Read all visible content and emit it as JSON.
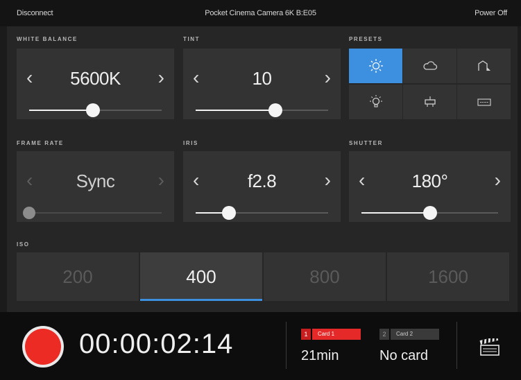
{
  "topbar": {
    "disconnect": "Disconnect",
    "camera_name": "Pocket Cinema Camera 6K B:E05",
    "power_off": "Power Off"
  },
  "white_balance": {
    "label": "WHITE BALANCE",
    "value": "5600K",
    "slider_level": 0.48
  },
  "tint": {
    "label": "TINT",
    "value": "10",
    "slider_level": 0.6
  },
  "presets": {
    "label": "PRESETS",
    "items": [
      {
        "icon": "sun-icon",
        "active": true
      },
      {
        "icon": "cloud-icon",
        "active": false
      },
      {
        "icon": "shade-icon",
        "active": false
      },
      {
        "icon": "tungsten-bulb-icon",
        "active": false
      },
      {
        "icon": "fluorescent-icon",
        "active": false
      },
      {
        "icon": "custom-icon",
        "active": false
      }
    ]
  },
  "frame_rate": {
    "label": "FRAME RATE",
    "value": "Sync",
    "slider_level": 0.0
  },
  "iris": {
    "label": "IRIS",
    "value": "f2.8",
    "slider_level": 0.25
  },
  "shutter": {
    "label": "SHUTTER",
    "value": "180°",
    "slider_level": 0.5
  },
  "iso": {
    "label": "ISO",
    "options": [
      "200",
      "400",
      "800",
      "1600"
    ],
    "selected": "400"
  },
  "record": {
    "timecode": "00:00:02:14"
  },
  "cards": [
    {
      "number": "1",
      "name": "Card 1",
      "value": "21min",
      "active": true
    },
    {
      "number": "2",
      "name": "Card 2",
      "value": "No card",
      "active": false
    }
  ],
  "colors": {
    "accent": "#3d8fe0",
    "record": "#ec2b24",
    "card_active": "#e52828"
  },
  "icons": {
    "arrow_left": "chevron-left-icon",
    "arrow_right": "chevron-right-icon",
    "slate": "clapperboard-icon"
  }
}
